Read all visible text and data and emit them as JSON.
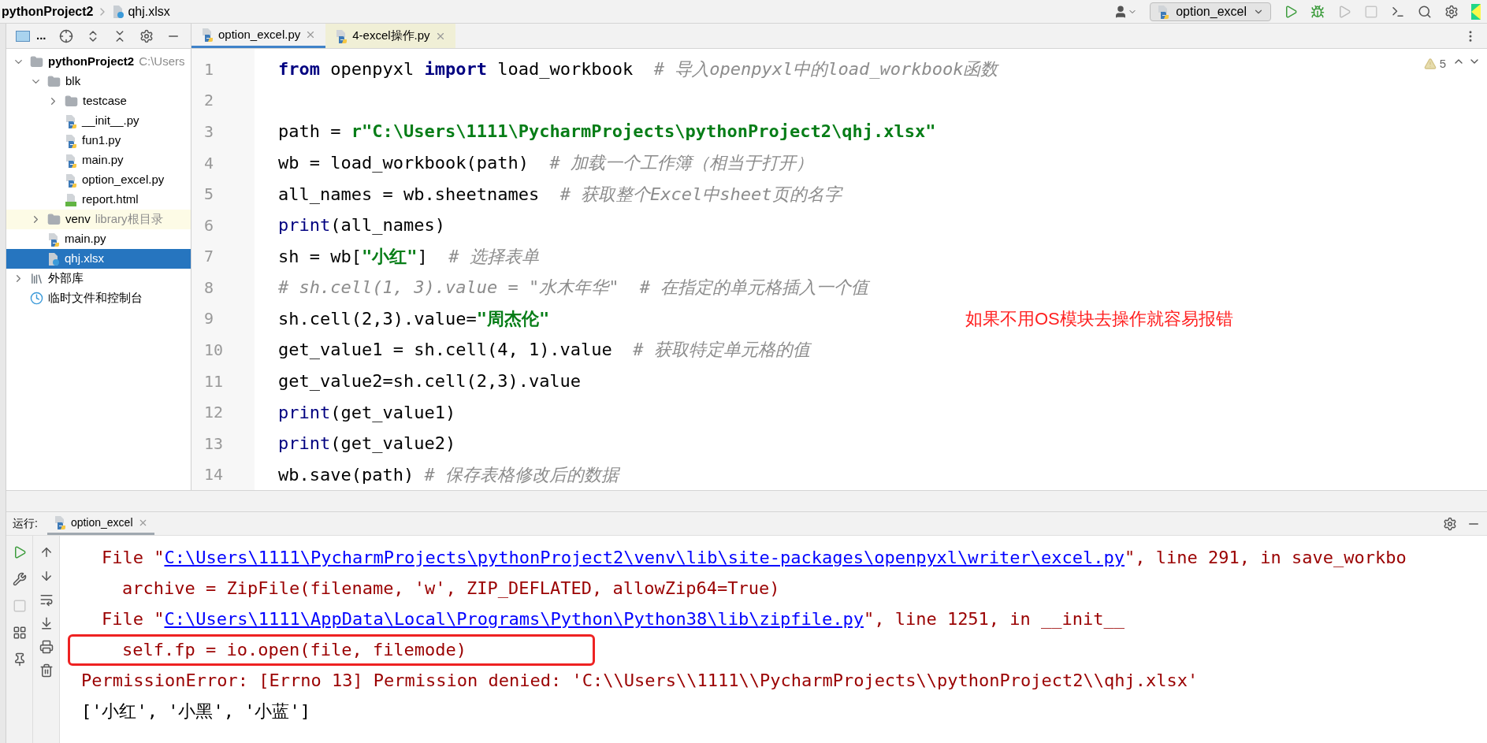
{
  "breadcrumb": [
    {
      "label": "pythonProject2"
    },
    {
      "label": "qhj.xlsx"
    }
  ],
  "run_config": "option_excel",
  "project_panel": {
    "title": "...",
    "tree": [
      {
        "label": "pythonProject2",
        "hint": "C:\\Users",
        "kind": "folder",
        "expanded": true,
        "selected": false,
        "children": [
          {
            "label": "blk",
            "kind": "package",
            "expanded": true,
            "selected": false,
            "children": [
              {
                "label": "testcase",
                "kind": "package",
                "expanded": false,
                "selected": false
              },
              {
                "label": "__init__.py",
                "kind": "python",
                "selected": false
              },
              {
                "label": "fun1.py",
                "kind": "python",
                "selected": false
              },
              {
                "label": "main.py",
                "kind": "python",
                "selected": false
              },
              {
                "label": "option_excel.py",
                "kind": "python",
                "selected": false
              },
              {
                "label": "report.html",
                "kind": "html",
                "selected": false
              }
            ]
          },
          {
            "label": "venv",
            "hint": "library根目录",
            "kind": "library",
            "expanded": false,
            "selected": false
          },
          {
            "label": "main.py",
            "kind": "python",
            "selected": false
          },
          {
            "label": "qhj.xlsx",
            "kind": "unknown",
            "selected": true
          }
        ]
      },
      {
        "label": "外部库",
        "kind": "libraries",
        "expanded": false,
        "selected": false
      },
      {
        "label": "临时文件和控制台",
        "kind": "scratches",
        "selected": false
      }
    ]
  },
  "editor_tabs": [
    {
      "label": "option_excel.py",
      "selected": true
    },
    {
      "label": "4-excel操作.py",
      "selected": false
    }
  ],
  "warnings": "5",
  "code": [
    {
      "number": "1",
      "tokens": [
        {
          "text": "from",
          "kind": "keyword"
        },
        {
          "text": " openpyxl ",
          "kind": "plain"
        },
        {
          "text": "import",
          "kind": "keyword"
        },
        {
          "text": " load_workbook  ",
          "kind": "plain"
        },
        {
          "text": "# 导入openpyxl中的load_workbook函数",
          "kind": "comment"
        }
      ]
    },
    {
      "number": "2"
    },
    {
      "number": "3",
      "tokens": [
        {
          "text": "path = ",
          "kind": "plain"
        },
        {
          "text": "r\"C:\\Users\\1111\\PycharmProjects\\pythonProject2\\qhj.xlsx\"",
          "kind": "string"
        }
      ]
    },
    {
      "number": "4",
      "tokens": [
        {
          "text": "wb = load_workbook(path)  ",
          "kind": "plain"
        },
        {
          "text": "# 加载一个工作簿（相当于打开）",
          "kind": "comment"
        }
      ]
    },
    {
      "number": "5",
      "tokens": [
        {
          "text": "all_names = wb.sheetnames  ",
          "kind": "plain"
        },
        {
          "text": "# 获取整个Excel中sheet页的名字",
          "kind": "comment"
        }
      ]
    },
    {
      "number": "6",
      "tokens": [
        {
          "text": "print",
          "kind": "builtin"
        },
        {
          "text": "(all_names)",
          "kind": "plain"
        }
      ]
    },
    {
      "number": "7",
      "tokens": [
        {
          "text": "sh = wb[",
          "kind": "plain"
        },
        {
          "text": "\"小红\"",
          "kind": "string"
        },
        {
          "text": "]  ",
          "kind": "plain"
        },
        {
          "text": "# 选择表单",
          "kind": "comment"
        }
      ]
    },
    {
      "number": "8",
      "tokens": [
        {
          "text": "# sh.cell(1, 3).value = \"水木年华\"  # 在指定的单元格插入一个值",
          "kind": "comment"
        }
      ]
    },
    {
      "number": "9",
      "tokens": [
        {
          "text": "sh.cell(2,3).value=",
          "kind": "plain"
        },
        {
          "text": "\"周杰伦\"",
          "kind": "string"
        }
      ]
    },
    {
      "number": "10",
      "tokens": [
        {
          "text": "get_value1 = sh.cell(4, 1).value  ",
          "kind": "plain"
        },
        {
          "text": "# 获取特定单元格的值",
          "kind": "comment"
        }
      ]
    },
    {
      "number": "11",
      "tokens": [
        {
          "text": "get_value2=sh.cell(2,3).value",
          "kind": "plain"
        }
      ]
    },
    {
      "number": "12",
      "tokens": [
        {
          "text": "print",
          "kind": "builtin"
        },
        {
          "text": "(get_value1)",
          "kind": "plain"
        }
      ]
    },
    {
      "number": "13",
      "tokens": [
        {
          "text": "print",
          "kind": "builtin"
        },
        {
          "text": "(get_value2)",
          "kind": "plain"
        }
      ]
    },
    {
      "number": "14",
      "tokens": [
        {
          "text": "wb.save(path) ",
          "kind": "plain"
        },
        {
          "text": "# 保存表格修改后的数据",
          "kind": "comment"
        }
      ]
    }
  ],
  "annotation": "如果不用OS模块去操作就容易报错",
  "run_panel": {
    "label": "运行:",
    "tab": "option_excel",
    "output": [
      {
        "kind": "frame",
        "highlighted": false,
        "segments": [
          {
            "text": "File \"",
            "kind": "error"
          },
          {
            "text": "C:\\Users\\1111\\PycharmProjects\\pythonProject2\\venv\\lib\\site-packages\\openpyxl\\writer\\excel.py",
            "kind": "link"
          },
          {
            "text": "\", line 291, in save_workbo",
            "kind": "error"
          }
        ]
      },
      {
        "kind": "source",
        "highlighted": false,
        "segments": [
          {
            "text": "archive = ZipFile(filename, 'w', ZIP_DEFLATED, allowZip64=True)",
            "kind": "error"
          }
        ]
      },
      {
        "kind": "frame",
        "highlighted": false,
        "segments": [
          {
            "text": "File \"",
            "kind": "error"
          },
          {
            "text": "C:\\Users\\1111\\AppData\\Local\\Programs\\Python\\Python38\\lib\\zipfile.py",
            "kind": "link"
          },
          {
            "text": "\", line 1251, in __init__",
            "kind": "error"
          }
        ]
      },
      {
        "kind": "source",
        "highlighted": true,
        "segments": [
          {
            "text": "self.fp = io.open(file, filemode)",
            "kind": "error"
          }
        ]
      },
      {
        "kind": "message",
        "highlighted": false,
        "segments": [
          {
            "text": "PermissionError: [Errno 13] Permission denied: 'C:\\\\Users\\\\1111\\\\PycharmProjects\\\\pythonProject2\\\\qhj.xlsx'",
            "kind": "error"
          }
        ]
      },
      {
        "kind": "message",
        "highlighted": false,
        "segments": [
          {
            "text": "['小红', '小黑', '小蓝']",
            "kind": "plain"
          }
        ]
      }
    ]
  }
}
